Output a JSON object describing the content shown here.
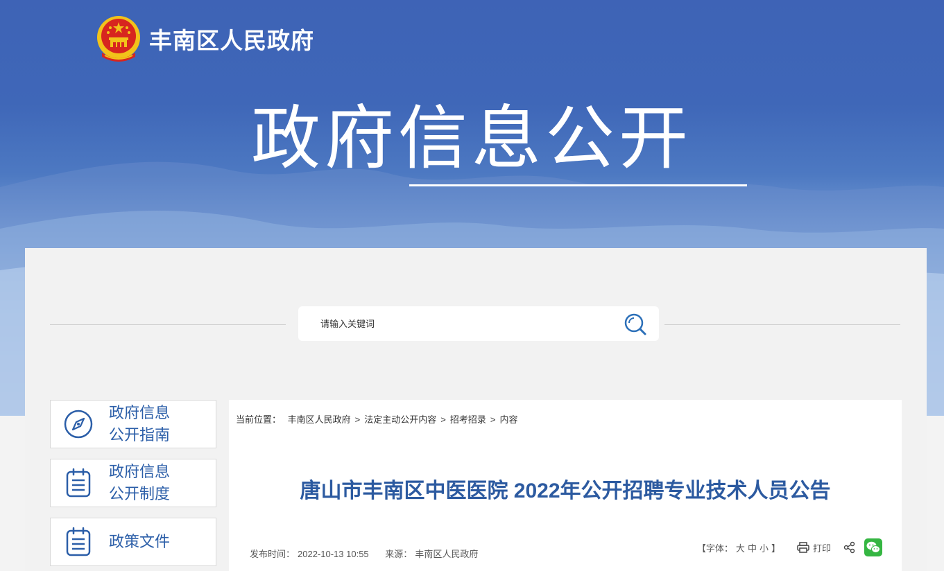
{
  "header": {
    "site_name": "丰南区人民政府",
    "hero_title": "政府信息公开",
    "emblem_icon": "national-emblem-icon"
  },
  "search": {
    "placeholder": "请输入关键词",
    "icon": "search-icon"
  },
  "sidebar": {
    "items": [
      {
        "line1": "政府信息",
        "line2": "公开指南",
        "icon": "compass-icon"
      },
      {
        "line1": "政府信息",
        "line2": "公开制度",
        "icon": "clipboard-icon"
      },
      {
        "line1": "政策文件",
        "line2": "",
        "icon": "clipboard-icon"
      }
    ]
  },
  "breadcrumb": {
    "label": "当前位置：",
    "items": [
      "丰南区人民政府",
      "法定主动公开内容",
      "招考招录",
      "内容"
    ],
    "separator": ">"
  },
  "article": {
    "title": "唐山市丰南区中医医院 2022年公开招聘专业技术人员公告",
    "publish_label": "发布时间：",
    "publish_time": "2022-10-13 10:55",
    "source_label": "来源：",
    "source": "丰南区人民政府"
  },
  "tools": {
    "font_label": "【字体：",
    "font_large": "大",
    "font_medium": "中",
    "font_small": "小",
    "font_end": "】",
    "print_label": "打印",
    "print_icon": "printer-icon",
    "share_icon": "share-icon",
    "wechat_icon": "wechat-icon"
  },
  "colors": {
    "banner_blue": "#3f67b8",
    "title_blue": "#2c5aa0",
    "wechat_green": "#35b642",
    "emblem_red": "#d7261f",
    "emblem_gold": "#f2c31a"
  }
}
